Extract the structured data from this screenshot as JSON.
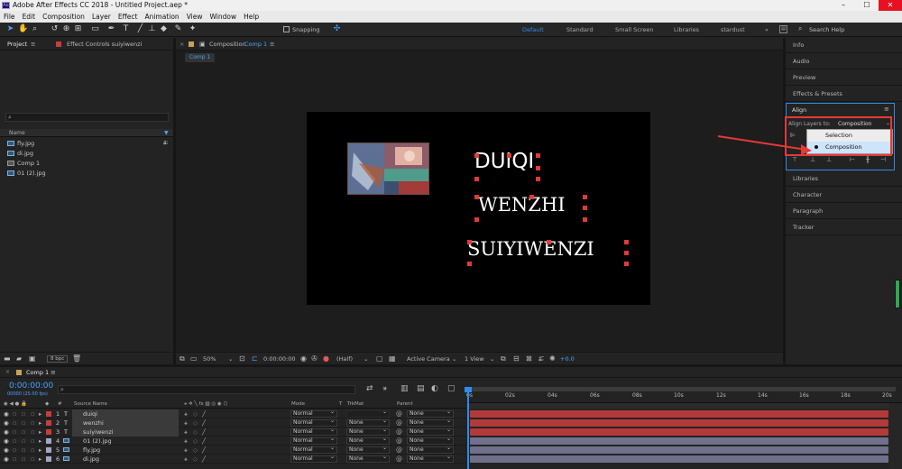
{
  "window": {
    "title": "Adobe After Effects CC 2018 - Untitled Project.aep *",
    "app_badge": "Ae"
  },
  "menu": [
    "File",
    "Edit",
    "Composition",
    "Layer",
    "Effect",
    "Animation",
    "View",
    "Window",
    "Help"
  ],
  "toolbar": {
    "snapping_label": "Snapping",
    "search_placeholder": "Search Help"
  },
  "workspaces": [
    "Default",
    "Standard",
    "Small Screen",
    "Libraries",
    "stardust"
  ],
  "project_panel": {
    "tab_project": "Project",
    "tab_effect_controls": "Effect Controls suiyiwenzi",
    "search_placeholder": "",
    "column_name": "Name",
    "items": [
      {
        "name": "fly.jpg",
        "kind": "image"
      },
      {
        "name": "di.jpg",
        "kind": "image"
      },
      {
        "name": "Comp 1",
        "kind": "comp"
      },
      {
        "name": "01 (2).jpg",
        "kind": "image"
      }
    ],
    "bpc": "8 bpc"
  },
  "comp_panel": {
    "tab_label": "Composition",
    "tab_comp": "Comp 1",
    "breadcrumb": "Comp 1",
    "zoom": "50%",
    "timecode": "0:00:00:00",
    "resolution": "(Half)",
    "camera": "Active Camera",
    "views": "1 View",
    "exposure": "+0.0",
    "canvas_texts": [
      "DUIQI",
      "WENZHI",
      "SUIYIWENZI"
    ]
  },
  "right_panel": {
    "items_top": [
      "Info",
      "Audio",
      "Preview",
      "Effects & Presets"
    ],
    "align": {
      "title": "Align",
      "align_to_label": "Align Layers to:",
      "align_to_value": "Composition",
      "options": [
        "Selection",
        "Composition"
      ],
      "selected": "Composition"
    },
    "items_bottom": [
      "Libraries",
      "Character",
      "Paragraph",
      "Tracker"
    ]
  },
  "timeline": {
    "tab": "Comp 1",
    "timecode": "0:00:00:00",
    "fps": "00000 (25.00 fps)",
    "search_placeholder": "",
    "col_source": "Source Name",
    "col_mode": "Mode",
    "col_t": "T",
    "col_trkmat": "TrkMat",
    "col_parent": "Parent",
    "ruler": [
      "0s",
      "02s",
      "04s",
      "06s",
      "08s",
      "10s",
      "12s",
      "14s",
      "16s",
      "18s",
      "20s"
    ],
    "layers": [
      {
        "num": "1",
        "type": "T",
        "name": "duiqi",
        "mode": "Normal",
        "trkmat": "",
        "parent": "None",
        "color": "#c83c3c",
        "selected": true,
        "track": "#b33a3a"
      },
      {
        "num": "2",
        "type": "T",
        "name": "wenzhi",
        "mode": "Normal",
        "trkmat": "None",
        "parent": "None",
        "color": "#c83c3c",
        "selected": true,
        "track": "#b33a3a"
      },
      {
        "num": "3",
        "type": "T",
        "name": "suiyiwenzi",
        "mode": "Normal",
        "trkmat": "None",
        "parent": "None",
        "color": "#c83c3c",
        "selected": true,
        "track": "#b33a3a"
      },
      {
        "num": "4",
        "type": "img",
        "name": "01 (2).jpg",
        "mode": "Normal",
        "trkmat": "None",
        "parent": "None",
        "color": "#a5a5c8",
        "selected": false,
        "track": "#70708c"
      },
      {
        "num": "5",
        "type": "img",
        "name": "fly.jpg",
        "mode": "Normal",
        "trkmat": "None",
        "parent": "None",
        "color": "#a5a5c8",
        "selected": false,
        "track": "#70708c"
      },
      {
        "num": "6",
        "type": "img",
        "name": "di.jpg",
        "mode": "Normal",
        "trkmat": "None",
        "parent": "None",
        "color": "#a5a5c8",
        "selected": false,
        "track": "#70708c"
      }
    ]
  },
  "colors": {
    "accent": "#2d8ceb",
    "highlight_red": "#e53935"
  }
}
